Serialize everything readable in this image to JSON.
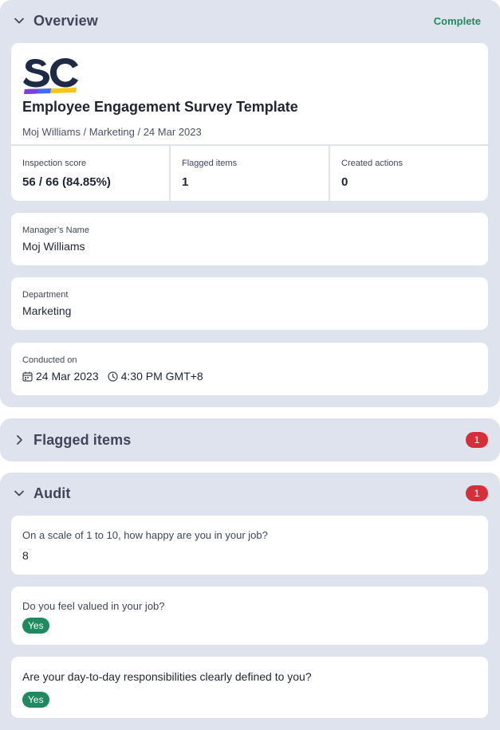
{
  "overview": {
    "title": "Overview",
    "status": "Complete",
    "logo_text": "SC",
    "doc_title": "Employee Engagement Survey Template",
    "doc_meta": "Moj Williams / Marketing / 24 Mar 2023",
    "stats": [
      {
        "label": "Inspection score",
        "value": "56 / 66 (84.85%)"
      },
      {
        "label": "Flagged items",
        "value": "1"
      },
      {
        "label": "Created actions",
        "value": "0"
      }
    ],
    "manager": {
      "label": "Manager’s Name",
      "value": "Moj Williams"
    },
    "department": {
      "label": "Department",
      "value": "Marketing"
    },
    "conducted": {
      "label": "Conducted on",
      "date": "24 Mar 2023",
      "time": "4:30 PM GMT+8"
    }
  },
  "flagged": {
    "title": "Flagged items",
    "count": "1"
  },
  "audit": {
    "title": "Audit",
    "count": "1",
    "questions": [
      {
        "question": "On a scale of 1 to 10, how happy are you in your job?",
        "answer": "8"
      },
      {
        "question": "Do you feel valued in your job?",
        "answer": "Yes"
      },
      {
        "question": "Are your day-to-day responsibilities clearly defined to you?",
        "answer": "Yes"
      }
    ]
  },
  "colors": {
    "section_bg": "#dfe3ee",
    "complete_green": "#1f8a5f",
    "badge_red": "#d62f3a",
    "logo_navy": "#1f2a44"
  },
  "icons": [
    "chevron-down-icon",
    "chevron-right-icon",
    "calendar-icon",
    "clock-icon"
  ]
}
